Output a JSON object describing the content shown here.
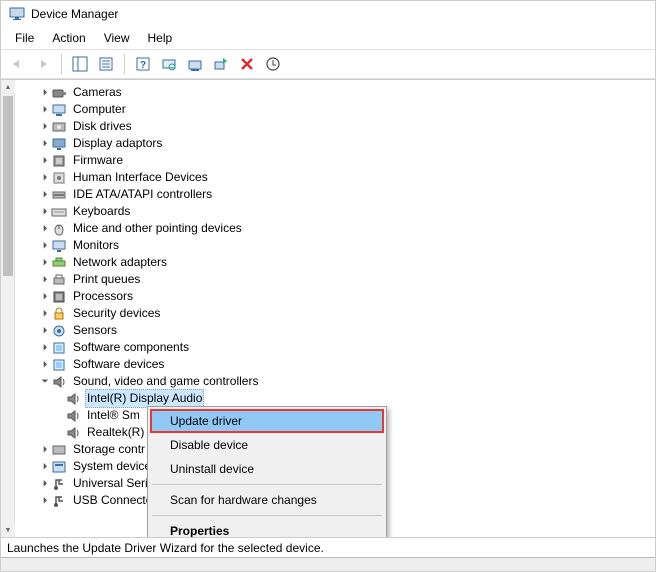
{
  "window": {
    "title": "Device Manager"
  },
  "menubar": [
    "File",
    "Action",
    "View",
    "Help"
  ],
  "tree": {
    "categories": [
      {
        "label": "Cameras",
        "expanded": false,
        "icon": "camera"
      },
      {
        "label": "Computer",
        "expanded": false,
        "icon": "computer"
      },
      {
        "label": "Disk drives",
        "expanded": false,
        "icon": "disk"
      },
      {
        "label": "Display adaptors",
        "expanded": false,
        "icon": "display"
      },
      {
        "label": "Firmware",
        "expanded": false,
        "icon": "chip"
      },
      {
        "label": "Human Interface Devices",
        "expanded": false,
        "icon": "hid"
      },
      {
        "label": "IDE ATA/ATAPI controllers",
        "expanded": false,
        "icon": "ide"
      },
      {
        "label": "Keyboards",
        "expanded": false,
        "icon": "keyboard"
      },
      {
        "label": "Mice and other pointing devices",
        "expanded": false,
        "icon": "mouse"
      },
      {
        "label": "Monitors",
        "expanded": false,
        "icon": "monitor"
      },
      {
        "label": "Network adapters",
        "expanded": false,
        "icon": "network"
      },
      {
        "label": "Print queues",
        "expanded": false,
        "icon": "printer"
      },
      {
        "label": "Processors",
        "expanded": false,
        "icon": "cpu"
      },
      {
        "label": "Security devices",
        "expanded": false,
        "icon": "security"
      },
      {
        "label": "Sensors",
        "expanded": false,
        "icon": "sensor"
      },
      {
        "label": "Software components",
        "expanded": false,
        "icon": "software"
      },
      {
        "label": "Software devices",
        "expanded": false,
        "icon": "software"
      },
      {
        "label": "Sound, video and game controllers",
        "expanded": true,
        "icon": "sound",
        "children": [
          {
            "label": "Intel(R) Display Audio",
            "icon": "speaker",
            "selected": true
          },
          {
            "label": "Intel® Sm",
            "icon": "speaker"
          },
          {
            "label": "Realtek(R)",
            "icon": "speaker"
          }
        ]
      },
      {
        "label": "Storage contr",
        "expanded": false,
        "icon": "storage"
      },
      {
        "label": "System device",
        "expanded": false,
        "icon": "system"
      },
      {
        "label": "Universal Seri",
        "expanded": false,
        "icon": "usb"
      },
      {
        "label": "USB Connecto",
        "expanded": false,
        "icon": "usb"
      }
    ]
  },
  "context_menu": {
    "items": [
      {
        "label": "Update driver",
        "highlighted": true
      },
      {
        "label": "Disable device"
      },
      {
        "label": "Uninstall device"
      },
      {
        "sep": true
      },
      {
        "label": "Scan for hardware changes"
      },
      {
        "sep": true
      },
      {
        "label": "Properties",
        "bold": true
      }
    ]
  },
  "statusbar": "Launches the Update Driver Wizard for the selected device."
}
